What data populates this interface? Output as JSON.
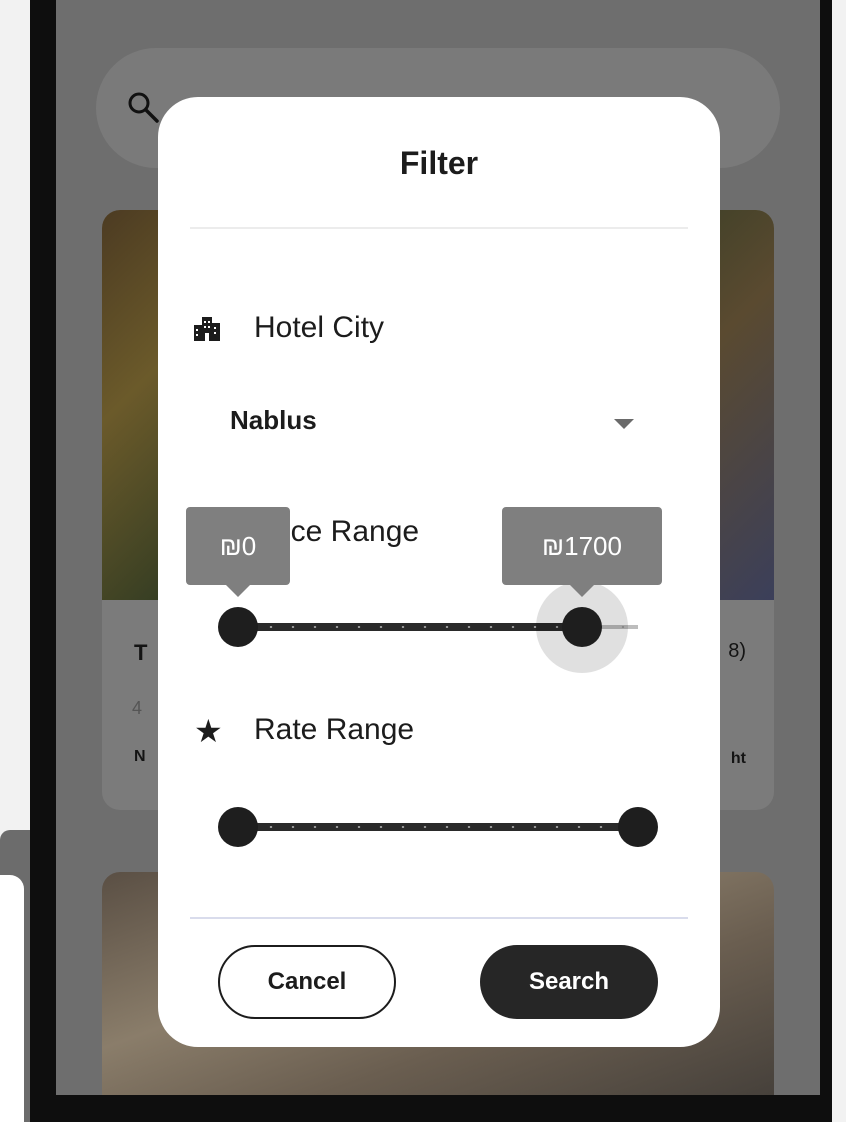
{
  "background": {
    "card": {
      "title_fragment": "T",
      "subtitle_fragment": "4",
      "location_fragment": "N",
      "reviews_fragment": "8)",
      "price_fragment": "ht"
    }
  },
  "dialog": {
    "title": "Filter",
    "city": {
      "label": "Hotel City",
      "icon": "city-buildings-icon",
      "selected": "Nablus"
    },
    "price": {
      "label": "Price Range",
      "icon": "price-tag-icon",
      "min_label": "₪0",
      "max_label": "₪1700",
      "min_fraction": 0.0,
      "max_fraction": 0.86
    },
    "rate": {
      "label": "Rate Range",
      "icon": "star-icon",
      "min_fraction": 0.0,
      "max_fraction": 1.0
    },
    "buttons": {
      "cancel": "Cancel",
      "search": "Search"
    }
  },
  "colors": {
    "scrim": "#6e6e6e",
    "dialog": "#ffffff",
    "slider": "#1e1e1e",
    "tooltip": "#7f7f7f",
    "primary_button": "#262626"
  }
}
